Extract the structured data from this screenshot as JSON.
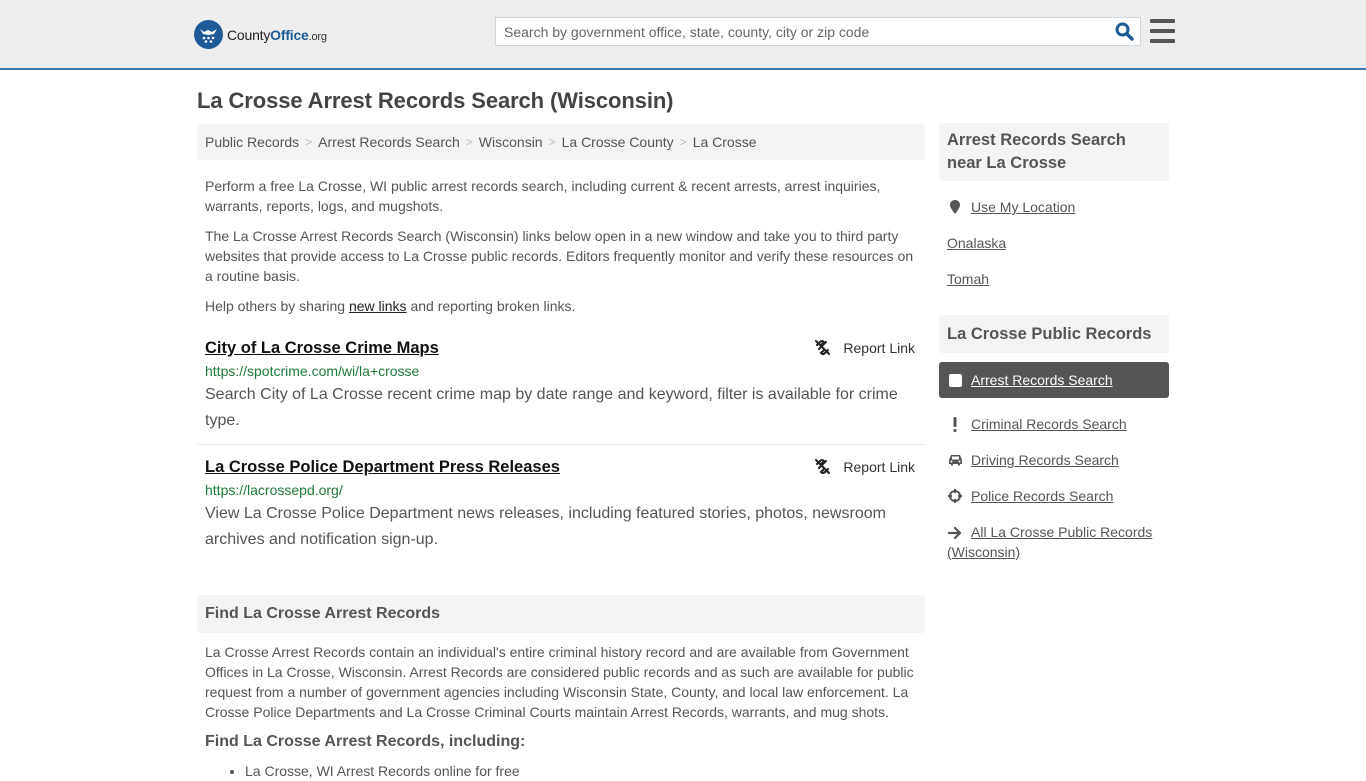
{
  "header": {
    "logo": {
      "brand_prefix": "County",
      "brand_main": "Office",
      "tld": ".org"
    },
    "search": {
      "placeholder": "Search by government office, state, county, city or zip code",
      "value": ""
    },
    "icons": {
      "search": "search-icon",
      "menu": "hamburger-menu-icon"
    },
    "accent_color": "#3a7aad"
  },
  "page_title": "La Crosse Arrest Records Search (Wisconsin)",
  "breadcrumb": [
    "Public Records",
    "Arrest Records Search",
    "Wisconsin",
    "La Crosse County",
    "La Crosse"
  ],
  "intro": {
    "p1": "Perform a free La Crosse, WI public arrest records search, including current & recent arrests, arrest inquiries, warrants, reports, logs, and mugshots.",
    "p2": "The La Crosse Arrest Records Search (Wisconsin) links below open in a new window and take you to third party websites that provide access to La Crosse public records. Editors frequently monitor and verify these resources on a routine basis.",
    "p3_before": "Help others by sharing ",
    "p3_link": "new links",
    "p3_after": " and reporting broken links."
  },
  "results": [
    {
      "title": "City of La Crosse Crime Maps",
      "url": "https://spotcrime.com/wi/la+crosse",
      "description": "Search City of La Crosse recent crime map by date range and keyword, filter is available for crime type.",
      "report_label": "Report Link"
    },
    {
      "title": "La Crosse Police Department Press Releases",
      "url": "https://lacrossepd.org/",
      "description": "View La Crosse Police Department news releases, including featured stories, photos, newsroom archives and notification sign-up.",
      "report_label": "Report Link"
    }
  ],
  "find_section": {
    "heading": "Find La Crosse Arrest Records",
    "body": "La Crosse Arrest Records contain an individual's entire criminal history record and are available from Government Offices in La Crosse, Wisconsin. Arrest Records are considered public records and as such are available for public request from a number of government agencies including Wisconsin State, County, and local law enforcement. La Crosse Police Departments and La Crosse Criminal Courts maintain Arrest Records, warrants, and mug shots.",
    "subheading": "Find La Crosse Arrest Records, including:",
    "items": [
      "La Crosse, WI Arrest Records online for free"
    ]
  },
  "sidebar": {
    "near": {
      "heading": "Arrest Records Search near La Crosse",
      "use_location": "Use My Location",
      "places": [
        "Onalaska",
        "Tomah"
      ]
    },
    "public_records": {
      "heading": "La Crosse Public Records",
      "items": [
        {
          "label": "Arrest Records Search",
          "icon": "square-icon",
          "active": true
        },
        {
          "label": "Criminal Records Search",
          "icon": "exclamation-icon",
          "active": false
        },
        {
          "label": "Driving Records Search",
          "icon": "car-icon",
          "active": false
        },
        {
          "label": "Police Records Search",
          "icon": "crosshairs-icon",
          "active": false
        },
        {
          "label": "All La Crosse Public Records (Wisconsin)",
          "icon": "arrow-right-icon",
          "active": false
        }
      ]
    }
  }
}
